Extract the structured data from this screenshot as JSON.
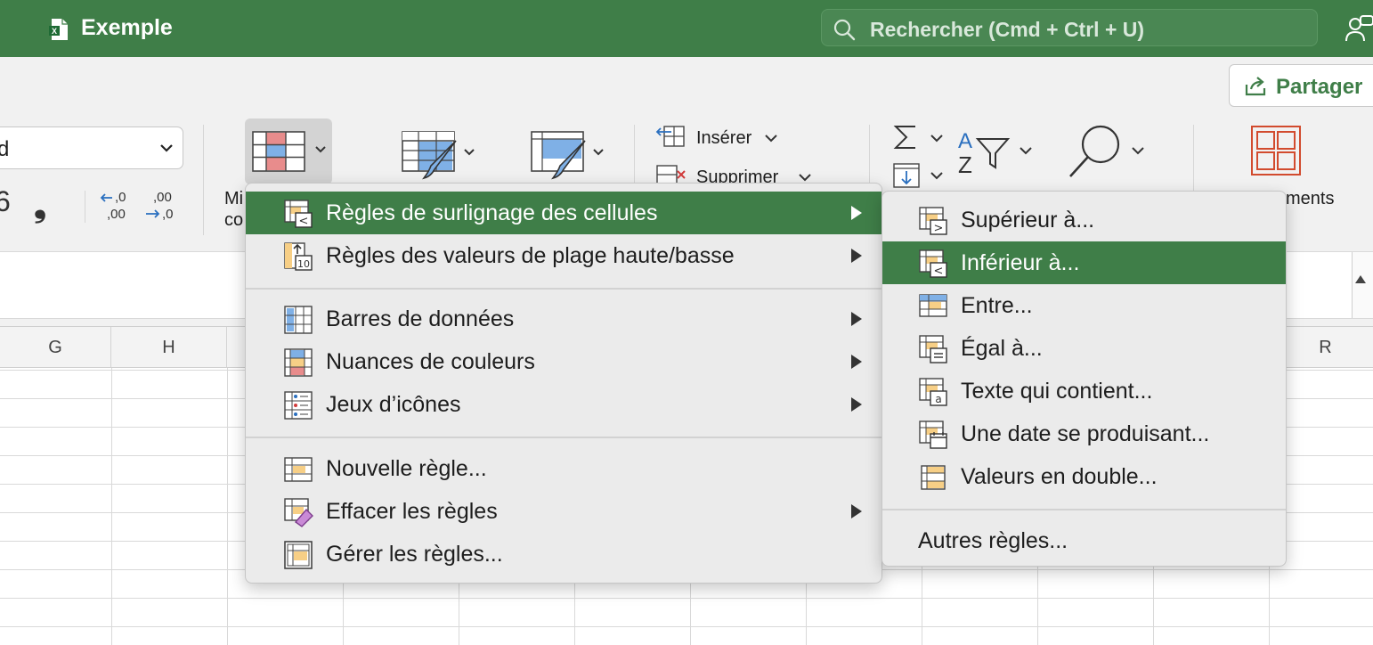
{
  "app": {
    "title": "Exemple"
  },
  "search": {
    "placeholder": "Rechercher (Cmd + Ctrl + U)"
  },
  "ribbon": {
    "share_label": "Partager",
    "font_name_partial": "d",
    "comma_glyph": "❟",
    "percent_glyph_partial": "6",
    "dec_increase": ",00",
    "dec_decrease": ",0",
    "insert_label": "Insérer",
    "delete_label": "Supprimer",
    "cf_label_partial_1": "Mi",
    "cf_label_partial_2": "co",
    "elements_label_partial": "ments"
  },
  "sheet": {
    "columns": [
      "G",
      "H",
      "R"
    ]
  },
  "cf_menu": {
    "items": [
      {
        "label": "Règles de surlignage des cellules",
        "submenu": true,
        "highlighted": true
      },
      {
        "label": "Règles des valeurs de plage haute/basse",
        "submenu": true
      },
      {
        "label": "Barres de données",
        "submenu": true
      },
      {
        "label": "Nuances de couleurs",
        "submenu": true
      },
      {
        "label": "Jeux d’icônes",
        "submenu": true
      },
      {
        "label": "Nouvelle règle...",
        "submenu": false
      },
      {
        "label": "Effacer les règles",
        "submenu": true
      },
      {
        "label": "Gérer les règles...",
        "submenu": false
      }
    ]
  },
  "highlight_submenu": {
    "items": [
      {
        "label": "Supérieur à..."
      },
      {
        "label": "Inférieur à...",
        "highlighted": true
      },
      {
        "label": "Entre..."
      },
      {
        "label": "Égal à..."
      },
      {
        "label": "Texte qui contient..."
      },
      {
        "label": "Une date se produisant..."
      },
      {
        "label": "Valeurs en double..."
      },
      {
        "label": "Autres règles..."
      }
    ]
  },
  "colors": {
    "accent": "#3f7e48",
    "menu_bg": "#ebebeb",
    "cf_red": "#e88c8c",
    "cf_blue": "#7fb0e6",
    "cf_yellow": "#f7cf86"
  }
}
